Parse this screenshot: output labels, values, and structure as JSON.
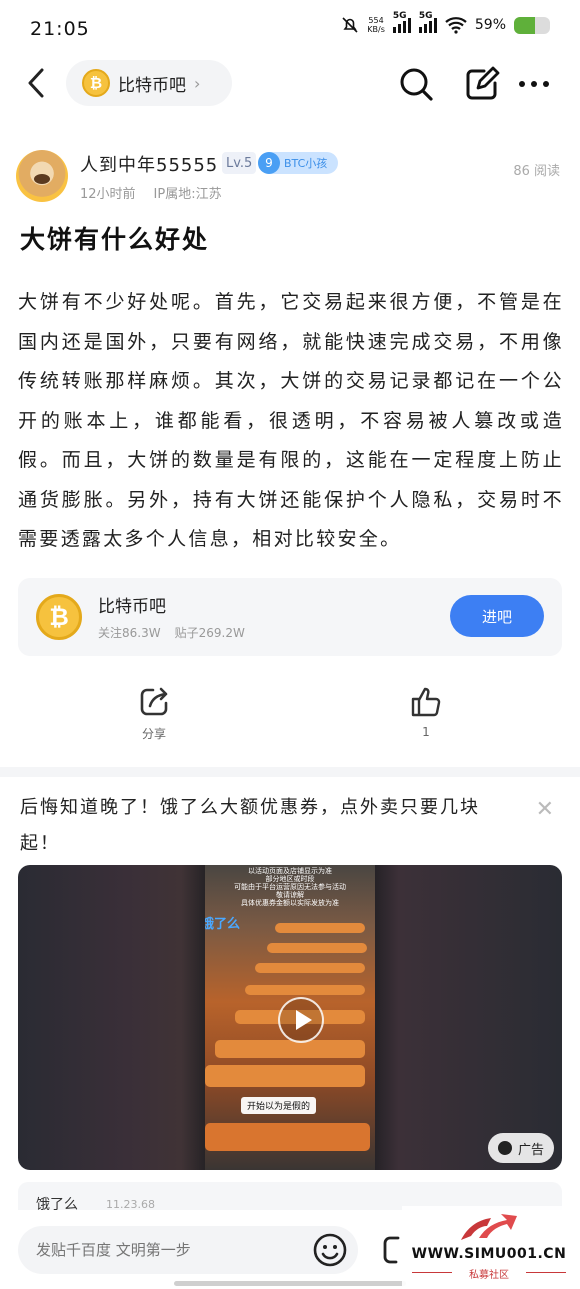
{
  "status_bar": {
    "time": "21:05",
    "net_speed_value": "554",
    "net_speed_unit": "KB/s",
    "sig1": "5G",
    "sig2": "5G",
    "battery": "59%",
    "battery_level": 0.59
  },
  "header": {
    "forum_name": "比特币吧"
  },
  "post": {
    "author": "人到中年55555",
    "level": "Lv.5",
    "fan_level": "9",
    "fan_name": "BTC小孩",
    "time": "12小时前",
    "ip": "IP属地:江苏",
    "views": "86 阅读",
    "title": "大饼有什么好处",
    "body": "大饼有不少好处呢。首先，它交易起来很方便，不管是在国内还是国外，只要有网络，就能快速完成交易，不用像传统转账那样麻烦。其次，大饼的交易记录都记在一个公开的账本上，谁都能看，很透明，不容易被人篡改或造假。而且，大饼的数量是有限的，这能在一定程度上防止通货膨胀。另外，持有大饼还能保护个人隐私，交易时不需要透露太多个人信息，相对比较安全。"
  },
  "forum_card": {
    "icon_glyph": "₿",
    "name": "比特币吧",
    "follow": "关注86.3W",
    "posts": "贴子269.2W",
    "enter": "进吧"
  },
  "actions": {
    "share": "分享",
    "like_count": "1"
  },
  "ad": {
    "title": "后悔知道晚了！饿了么大额优惠券，点外卖只要几块起！",
    "video_caption": "以活动页面及店铺显示为准\n部分地区或时段\n可能由于平台运营原因无法参与活动\n敬请谅解\n具体优惠券金额以实际发放为准",
    "video_logo": "饿了么",
    "video_subtitle": "开始以为是假的",
    "badge": "广告",
    "source": "饿了么",
    "source_code": "11.23.68"
  },
  "bottom": {
    "placeholder": "发贴千百度 文明第一步"
  },
  "watermark": {
    "url": "WWW.SIMU001.CN",
    "name": "私募社区"
  }
}
